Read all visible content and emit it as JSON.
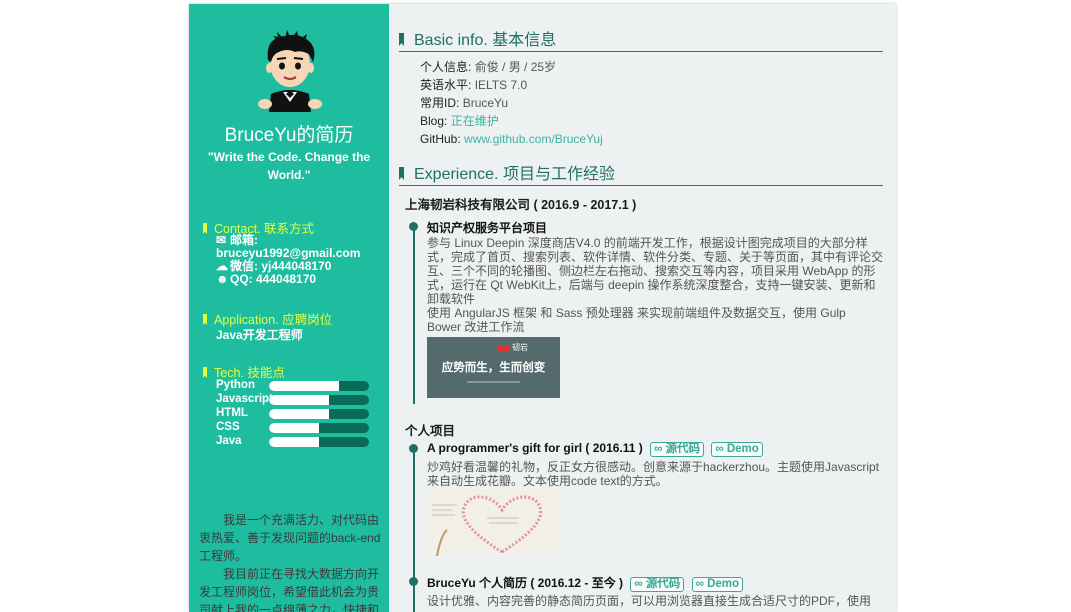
{
  "sidebar": {
    "name": "BruceYu的简历",
    "motto": "\"Write the Code. Change the World.\"",
    "contact_heading": "Contact. 联系方式",
    "email_label": "邮箱:",
    "email": "bruceyu1992@gmail.com",
    "wechat": "微信: yj444048170",
    "qq": "QQ: 444048170",
    "application_heading": "Application. 应聘岗位",
    "application_value": "Java开发工程师",
    "tech_heading": "Tech. 技能点",
    "skills": [
      {
        "name": "Python",
        "level": 0.7
      },
      {
        "name": "Javascript",
        "level": 0.6
      },
      {
        "name": "HTML",
        "level": 0.6
      },
      {
        "name": "CSS",
        "level": 0.5
      },
      {
        "name": "Java",
        "level": 0.5
      }
    ],
    "about_p1": "我是一个充满活力、对代码由衷热爱、善于发现问题的back-end工程师。",
    "about_p2": "我目前正在寻找大数据方向开发工程师岗位，希望借此机会为贵司献上我的一点绵薄之力，快捷和"
  },
  "basic": {
    "heading": "Basic info. 基本信息",
    "personal_label": "个人信息:",
    "personal_value": "俞俊 / 男 / 25岁",
    "english_label": "英语水平:",
    "english_value": "IELTS 7.0",
    "id_label": "常用ID:",
    "id_value": "BruceYu",
    "blog_label": "Blog:",
    "blog_value": "正在维护",
    "github_label": "GitHub:",
    "github_value": "www.github.com/BruceYuj"
  },
  "experience": {
    "heading": "Experience. 项目与工作经验",
    "company": "上海韧岩科技有限公司 ( 2016.9 - 2017.1 )",
    "project1_title": "知识产权服务平台项目",
    "project1_desc1": "参与 Linux Deepin 深度商店V4.0 的前端开发工作，根据设计图完成项目的大部分样式，完成了首页、搜索列表、软件详情、软件分类、专题、关于等页面，其中有评论交互、三个不同的轮播图、侧边栏左右拖动、搜索交互等内容，项目采用 WebApp 的形式，运行在 Qt WebKit上，后端与 deepin 操作系统深度整合，支持一键安装、更新和卸载软件",
    "project1_desc2": "使用 AngularJS 框架 和 Sass 预处理器 来实现前端组件及数据交互，使用 Gulp Bower 改进工作流",
    "project1_image_brand": "韧岩",
    "project1_image_slogan": "应势而生，生而创变",
    "personal_heading": "个人项目",
    "project2_title": "A programmer's gift for girl ( 2016.11 )",
    "project2_desc": "炒鸡好看温馨的礼物，反正女方很感动。创意来源于hackerzhou。主题使用Javascript来自动生成花瓣。文本使用code text的方式。",
    "project3_title": "BruceYu 个人简历 ( 2016.12 - 至今 )",
    "project3_desc": "设计优雅、内容完善的静态简历页面，可以用浏览器直接生成合适尺寸的PDF，使用",
    "source_label": "源代码",
    "demo_label": "Demo"
  },
  "colors": {
    "sidebar": "#1ebda0",
    "accent": "#1f6f62",
    "highlight": "#e6ff3c",
    "link": "#3cb3a0"
  }
}
